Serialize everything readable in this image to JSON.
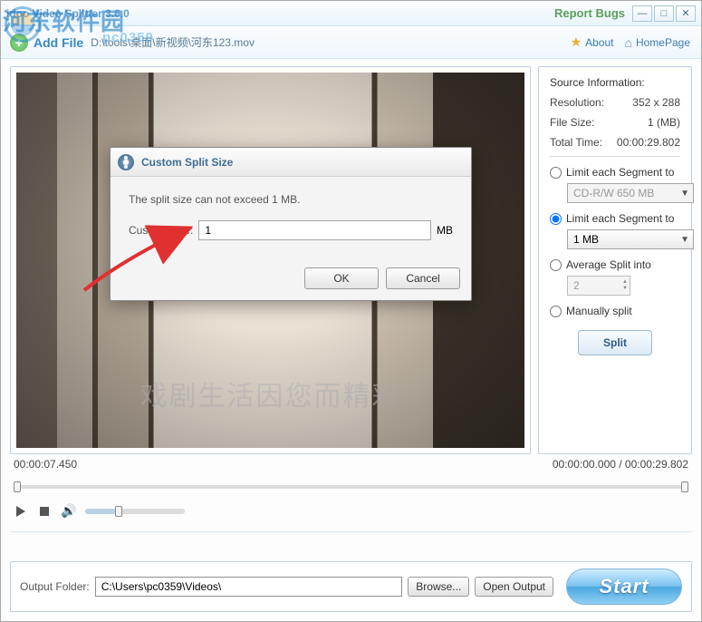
{
  "window": {
    "title": "idoo Video Splitter 3.6.0",
    "report_bugs": "Report Bugs"
  },
  "toolbar": {
    "add_file": "Add File",
    "file_path": "D:\\tools\\桌面\\新视频\\河东123.mov",
    "about": "About",
    "homepage": "HomePage"
  },
  "watermark": {
    "main": "河东软件园",
    "sub": "pc0359"
  },
  "video": {
    "subtitle": "戏剧生活因您而精彩"
  },
  "dialog": {
    "title": "Custom Split Size",
    "message": "The split size can not  exceed  1 MB.",
    "custom_size_label": "Custom Size:",
    "custom_size_value": "1",
    "unit": "MB",
    "ok": "OK",
    "cancel": "Cancel"
  },
  "source": {
    "title": "Source Information:",
    "resolution_label": "Resolution:",
    "resolution_value": "352 x 288",
    "filesize_label": "File Size:",
    "filesize_value": "1 (MB)",
    "totaltime_label": "Total Time:",
    "totaltime_value": "00:00:29.802"
  },
  "options": {
    "limit1_label": "Limit each Segment to",
    "limit1_value": "CD-R/W 650 MB",
    "limit2_label": "Limit each Segment to",
    "limit2_value": "1 MB",
    "avg_label": "Average Split into",
    "avg_value": "2",
    "manual_label": "Manually split",
    "split_btn": "Split"
  },
  "time": {
    "current": "00:00:07.450",
    "range": "00:00:00.000 / 00:00:29.802"
  },
  "output": {
    "label": "Output Folder:",
    "path": "C:\\Users\\pc0359\\Videos\\",
    "browse": "Browse...",
    "open": "Open Output",
    "start": "Start"
  }
}
